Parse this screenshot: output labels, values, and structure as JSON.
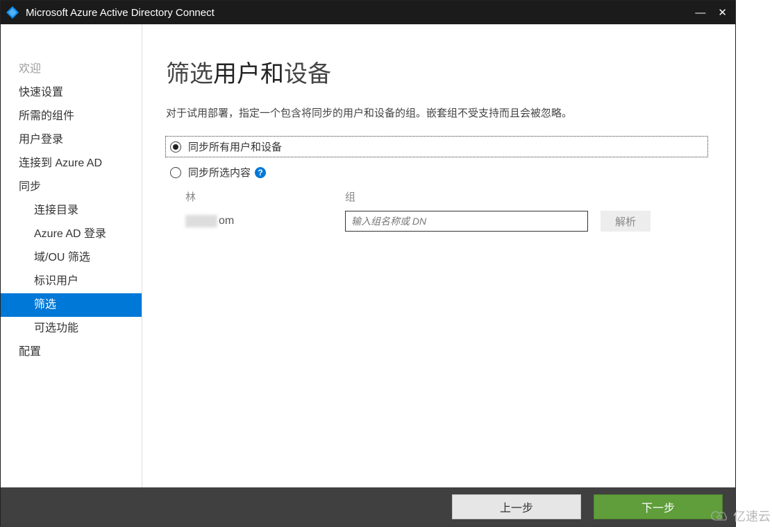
{
  "titlebar": {
    "title": "Microsoft Azure Active Directory Connect"
  },
  "sidebar": {
    "items": [
      {
        "label": "欢迎",
        "indent": 0,
        "state": "muted"
      },
      {
        "label": "快速设置",
        "indent": 0,
        "state": "normal"
      },
      {
        "label": "所需的组件",
        "indent": 0,
        "state": "normal"
      },
      {
        "label": "用户登录",
        "indent": 0,
        "state": "normal"
      },
      {
        "label": "连接到 Azure AD",
        "indent": 0,
        "state": "normal"
      },
      {
        "label": "同步",
        "indent": 0,
        "state": "normal"
      },
      {
        "label": "连接目录",
        "indent": 1,
        "state": "normal"
      },
      {
        "label": "Azure AD 登录",
        "indent": 1,
        "state": "normal"
      },
      {
        "label": "域/OU 筛选",
        "indent": 1,
        "state": "normal"
      },
      {
        "label": "标识用户",
        "indent": 1,
        "state": "normal"
      },
      {
        "label": "筛选",
        "indent": 1,
        "state": "active"
      },
      {
        "label": "可选功能",
        "indent": 1,
        "state": "normal"
      },
      {
        "label": "配置",
        "indent": 0,
        "state": "normal"
      }
    ]
  },
  "main": {
    "heading_prefix": "筛选",
    "heading_bold": "用户和",
    "heading_suffix": "设备",
    "description": "对于试用部署，指定一个包含将同步的用户和设备的组。嵌套组不受支持而且会被忽略。",
    "radio": {
      "all_label": "同步所有用户和设备",
      "selected_label": "同步所选内容",
      "help_glyph": "?"
    },
    "grid": {
      "header_forest": "林",
      "header_group": "组",
      "forest_suffix": "om",
      "group_placeholder": "输入组名称或 DN",
      "resolve_label": "解析"
    }
  },
  "footer": {
    "prev_label": "上一步",
    "next_label": "下一步"
  },
  "watermark": {
    "text": "亿速云"
  }
}
